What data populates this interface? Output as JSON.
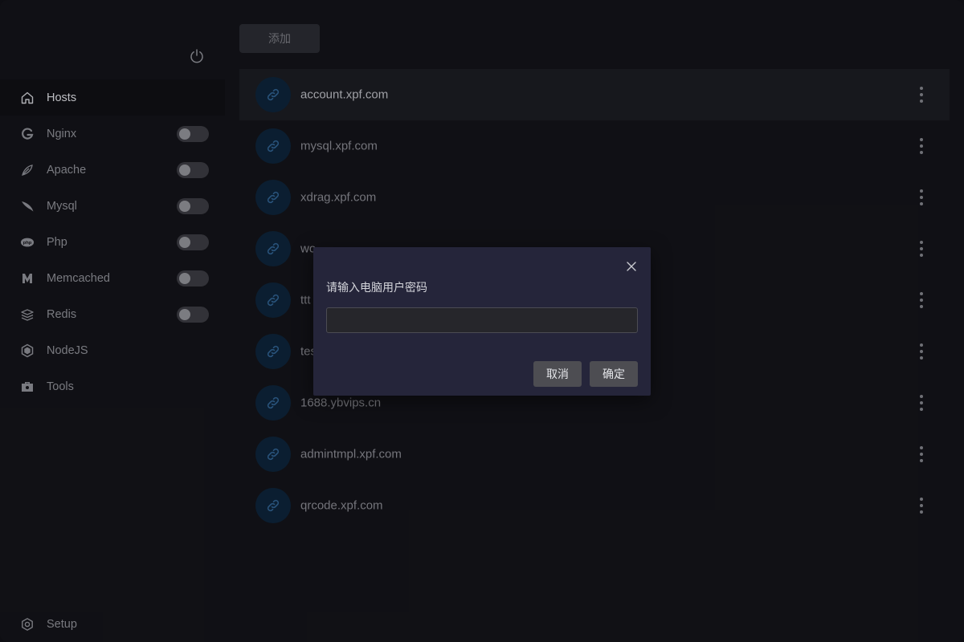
{
  "sidebar": {
    "items": [
      {
        "label": "Hosts",
        "icon": "home-icon",
        "active": true,
        "has_toggle": false
      },
      {
        "label": "Nginx",
        "icon": "nginx-icon",
        "has_toggle": true,
        "enabled": false
      },
      {
        "label": "Apache",
        "icon": "apache-feather-icon",
        "has_toggle": true,
        "enabled": false
      },
      {
        "label": "Mysql",
        "icon": "mysql-dolphin-icon",
        "has_toggle": true,
        "enabled": false
      },
      {
        "label": "Php",
        "icon": "php-icon",
        "has_toggle": true,
        "enabled": false
      },
      {
        "label": "Memcached",
        "icon": "memcached-icon",
        "has_toggle": true,
        "enabled": false
      },
      {
        "label": "Redis",
        "icon": "redis-stack-icon",
        "has_toggle": true,
        "enabled": false
      },
      {
        "label": "NodeJS",
        "icon": "nodejs-hexagon-icon",
        "has_toggle": false
      },
      {
        "label": "Tools",
        "icon": "toolbox-icon",
        "has_toggle": false
      }
    ],
    "setup_label": "Setup"
  },
  "toolbar": {
    "add_label": "添加"
  },
  "hosts": [
    {
      "name": "account.xpf.com",
      "active": true
    },
    {
      "name": "mysql.xpf.com"
    },
    {
      "name": "xdrag.xpf.com"
    },
    {
      "name": "wo",
      "obscured": true
    },
    {
      "name": "ttt",
      "obscured": true
    },
    {
      "name": "tes",
      "obscured": true
    },
    {
      "name": "1688.ybvips.cn"
    },
    {
      "name": "admintmpl.xpf.com"
    },
    {
      "name": "qrcode.xpf.com"
    }
  ],
  "dialog": {
    "title": "请输入电脑用户密码",
    "input_value": "",
    "input_placeholder": "",
    "cancel_label": "取消",
    "ok_label": "确定"
  },
  "colors": {
    "background": "#131318",
    "dialog": "#25253a",
    "avatar": "#0d2338",
    "link_icon": "#2f5f8d"
  }
}
